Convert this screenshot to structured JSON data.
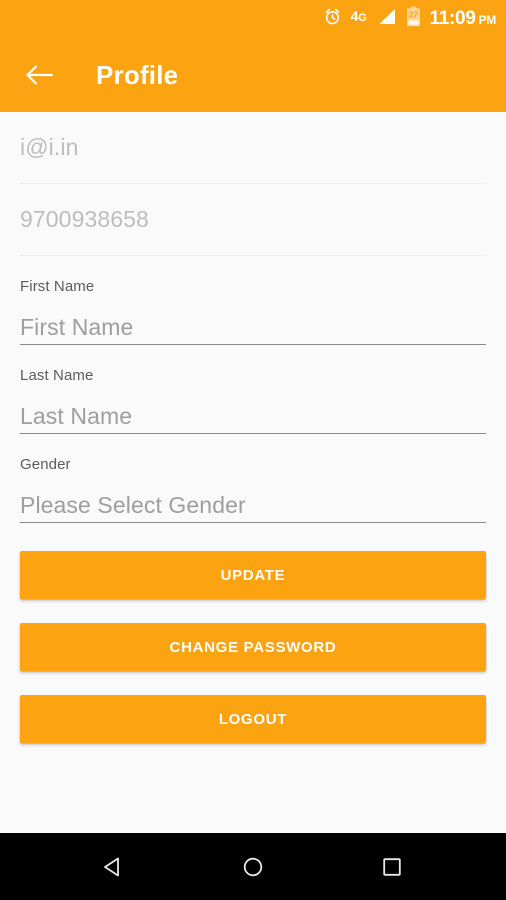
{
  "status_bar": {
    "alarm_icon": "alarm-clock-icon",
    "network_type": "4G",
    "network_type_main": "4",
    "network_type_sub": "G",
    "signal_icon": "signal-triangle-icon",
    "battery_icon": "battery-icon",
    "battery_level": "27",
    "time": "11:09",
    "meridiem": "PM",
    "background_color": "#FCA311",
    "foreground_color": "#FFFFFF"
  },
  "app_bar": {
    "back_icon": "back-arrow-icon",
    "title": "Profile",
    "background_color": "#FCA311",
    "text_color": "#FFFFFF"
  },
  "form": {
    "email": {
      "value": "i@i.in",
      "placeholder": "i@i.in",
      "editable": false
    },
    "phone": {
      "value": "9700938658",
      "placeholder": "9700938658",
      "editable": false
    },
    "first_name": {
      "label": "First Name",
      "value": "",
      "placeholder": "First Name"
    },
    "last_name": {
      "label": "Last Name",
      "value": "",
      "placeholder": "Last Name"
    },
    "gender": {
      "label": "Gender",
      "value": "",
      "placeholder": "Please Select Gender",
      "options": []
    }
  },
  "buttons": {
    "update": "UPDATE",
    "change_password": "CHANGE PASSWORD",
    "logout": "LOGOUT",
    "color": "#FCA311",
    "text_color": "#FFFFFF"
  },
  "nav_bar": {
    "back": "back-triangle-icon",
    "home": "home-circle-icon",
    "recents": "recents-square-icon",
    "background_color": "#000000"
  }
}
